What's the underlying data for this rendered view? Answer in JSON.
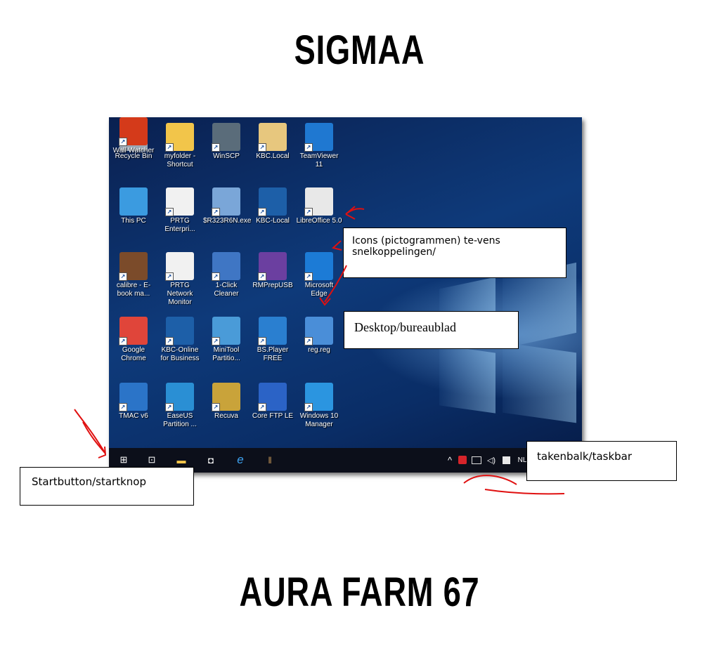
{
  "meme": {
    "top_text": "SIGMAA",
    "bottom_text": "AURA FARM 67"
  },
  "desktop": {
    "icons": [
      {
        "label": "Recycle Bin",
        "icon": "recycle-bin-icon",
        "color": "#9aa7b5"
      },
      {
        "label": "myfolder - Shortcut",
        "icon": "folder-icon",
        "color": "#f2c54a"
      },
      {
        "label": "WinSCP",
        "icon": "winscp-icon",
        "color": "#5a6c7a"
      },
      {
        "label": "KBC.Local",
        "icon": "folder-icon",
        "color": "#e7c77e"
      },
      {
        "label": "TeamViewer 11",
        "icon": "teamviewer-icon",
        "color": "#1f78d1"
      },
      {
        "label": "This PC",
        "icon": "computer-icon",
        "color": "#3b9be0"
      },
      {
        "label": "PRTG Enterpri...",
        "icon": "gauge-icon",
        "color": "#f1f1f1"
      },
      {
        "label": "$R323R6N.exe",
        "icon": "installer-icon",
        "color": "#7aa6d8"
      },
      {
        "label": "KBC-Local",
        "icon": "kbc-icon",
        "color": "#1d5fa8"
      },
      {
        "label": "LibreOffice 5.0",
        "icon": "document-icon",
        "color": "#e8e8e8"
      },
      {
        "label": "calibre - E-book ma...",
        "icon": "books-icon",
        "color": "#7b4b2a"
      },
      {
        "label": "PRTG Network Monitor",
        "icon": "gauge-icon",
        "color": "#f1f1f1"
      },
      {
        "label": "1-Click Cleaner",
        "icon": "broom-icon",
        "color": "#3f76c4"
      },
      {
        "label": "RMPrepUSB",
        "icon": "rm-icon",
        "color": "#6b3fa0"
      },
      {
        "label": "Microsoft Edge",
        "icon": "edge-icon",
        "color": "#1c7bd6"
      },
      {
        "label": "Google Chrome",
        "icon": "chrome-icon",
        "color": "#e0453a"
      },
      {
        "label": "KBC-Online for Business",
        "icon": "kbc-icon",
        "color": "#1d5fa8"
      },
      {
        "label": "MiniTool Partitio...",
        "icon": "partition-icon",
        "color": "#4a9bd8"
      },
      {
        "label": "BS.Player FREE",
        "icon": "player-icon",
        "color": "#2a7fd0"
      },
      {
        "label": "reg.reg",
        "icon": "registry-icon",
        "color": "#4a8ed8"
      },
      {
        "label": "TMAC v6",
        "icon": "tmac-icon",
        "color": "#2b74c8"
      },
      {
        "label": "EaseUS Partition ...",
        "icon": "easeus-icon",
        "color": "#2a8fd4"
      },
      {
        "label": "Recuva",
        "icon": "recuva-icon",
        "color": "#c9a33a"
      },
      {
        "label": "Core FTP LE",
        "icon": "ftp-icon",
        "color": "#2b63c6"
      },
      {
        "label": "Windows 10 Manager",
        "icon": "win10-manager-icon",
        "color": "#2b95e0"
      },
      {
        "label": "Wall Watcher",
        "icon": "eye-icon",
        "color": "#d43a1a"
      }
    ]
  },
  "taskbar": {
    "icons": [
      {
        "icon": "windows-start-icon",
        "glyph": "⊞"
      },
      {
        "icon": "task-view-icon",
        "glyph": "⊡"
      },
      {
        "icon": "file-explorer-icon",
        "glyph": "▬"
      },
      {
        "icon": "store-icon",
        "glyph": "◘"
      },
      {
        "icon": "edge-icon",
        "glyph": "e"
      },
      {
        "icon": "calibre-icon",
        "glyph": "ǁ"
      }
    ],
    "tray_glyphs": "^",
    "language": "NL"
  },
  "callouts": {
    "icons_label": "Icons (pictogrammen) te-vens  snelkoppelingen/",
    "desktop_label": "Desktop/bureaublad",
    "taskbar_label": "takenbalk/taskbar",
    "start_label": "Startbutton/startknop"
  },
  "colors": {
    "annotation_red": "#e01010",
    "taskbar": "#0c0f1a"
  }
}
